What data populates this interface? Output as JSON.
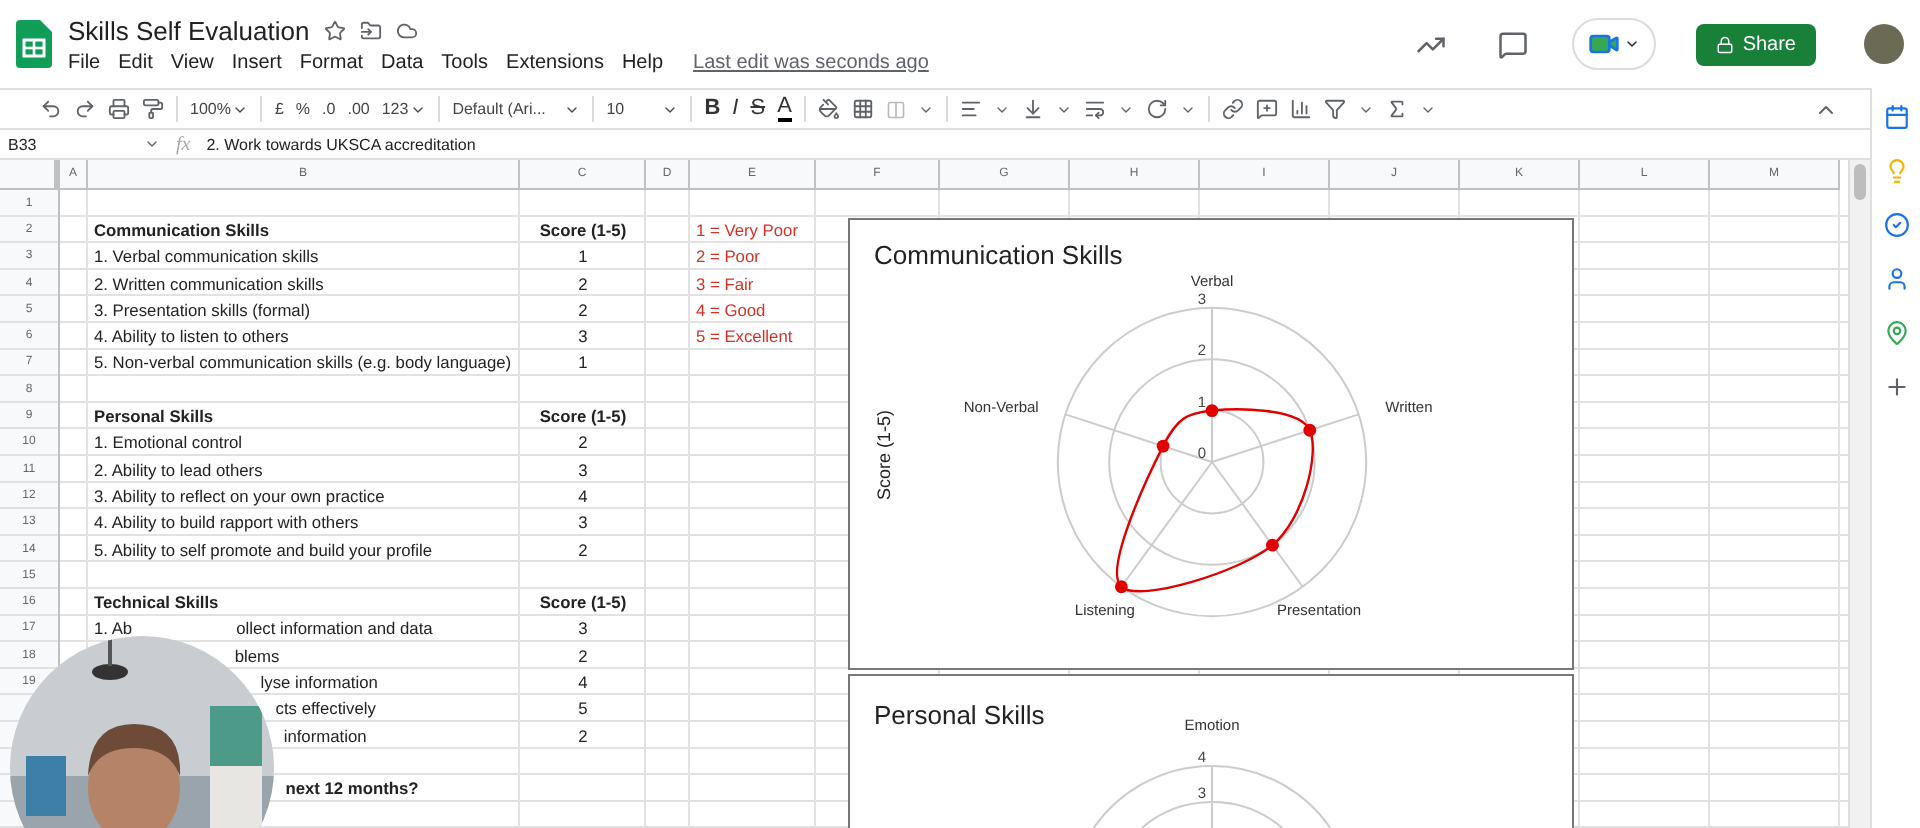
{
  "document": {
    "title": "Skills Self Evaluation",
    "last_edit": "Last edit was seconds ago"
  },
  "menu": [
    "File",
    "Edit",
    "View",
    "Insert",
    "Format",
    "Data",
    "Tools",
    "Extensions",
    "Help"
  ],
  "share_button": "Share",
  "toolbar": {
    "zoom": "100%",
    "currency": "£",
    "percent": "%",
    "decrease_decimals": ".0",
    "increase_decimals": ".00",
    "number_format": "123",
    "font": "Default (Ari...",
    "font_size": "10",
    "bold": "B",
    "italic": "I",
    "strikethrough": "S",
    "text_color": "A"
  },
  "formula_bar": {
    "cell": "B33",
    "function_label": "fx",
    "formula": "2. Work towards UKSCA accreditation"
  },
  "columns": [
    "A",
    "B",
    "C",
    "D",
    "E",
    "F",
    "G",
    "H",
    "I",
    "J",
    "K",
    "L",
    "M"
  ],
  "rows": [
    {
      "number": "1"
    },
    {
      "number": "2",
      "bold": true,
      "b": "Communication Skills",
      "c": "Score (1-5)",
      "e": "1 = Very Poor"
    },
    {
      "number": "3",
      "bold": false,
      "b": "1. Verbal communication skills",
      "c": "1",
      "e": "2 = Poor"
    },
    {
      "number": "4",
      "bold": false,
      "b": "2. Written communication skills",
      "c": "2",
      "e": "3 = Fair"
    },
    {
      "number": "5",
      "bold": false,
      "b": "3. Presentation skills (formal)",
      "c": "2",
      "e": "4 = Good"
    },
    {
      "number": "6",
      "bold": false,
      "b": "4. Ability to listen to others",
      "c": "3",
      "e": "5 = Excellent"
    },
    {
      "number": "7",
      "bold": false,
      "b": "5. Non-verbal communication skills (e.g. body language)",
      "c": "1"
    },
    {
      "number": "8"
    },
    {
      "number": "9",
      "bold": true,
      "b": "Personal Skills",
      "c": "Score (1-5)"
    },
    {
      "number": "10",
      "bold": false,
      "b": "1. Emotional control",
      "c": "2"
    },
    {
      "number": "11",
      "bold": false,
      "b": "2. Ability to lead others",
      "c": "3"
    },
    {
      "number": "12",
      "bold": false,
      "b": "3. Ability to reflect on your own practice",
      "c": "4"
    },
    {
      "number": "13",
      "bold": false,
      "b": "4. Ability to build rapport with others",
      "c": "3"
    },
    {
      "number": "14",
      "bold": false,
      "b": "5. Ability to self promote and build your profile",
      "c": "2"
    },
    {
      "number": "15"
    },
    {
      "number": "16",
      "bold": true,
      "b": "Technical Skills",
      "c": "Score (1-5)"
    },
    {
      "number": "17",
      "bold": false,
      "b_head": "1. Ab",
      "b": "ollect information and data",
      "c": "3"
    },
    {
      "number": "18",
      "bold": false,
      "b": "blems",
      "c": "2"
    },
    {
      "number": "19",
      "bold": false,
      "b": "lyse information",
      "c": "4"
    },
    {
      "bold": false,
      "b": "cts effectively",
      "c": "5"
    },
    {
      "bold": false,
      "b": "information",
      "c": "2"
    },
    {},
    {
      "bold": true,
      "b": "next 12 months?"
    },
    {}
  ],
  "charts": [
    {
      "title": "Communication Skills",
      "ylabel": "Score (1-5)",
      "ticks": [
        "3",
        "2",
        "1",
        "0"
      ],
      "axes": [
        "Verbal",
        "Written",
        "Presentation",
        "Listening",
        "Non-Verbal"
      ]
    }
  ],
  "partial_chart": {
    "title": "Personal Skills",
    "axis_label": "Emotion",
    "ticks": [
      "4",
      "3"
    ]
  }
}
